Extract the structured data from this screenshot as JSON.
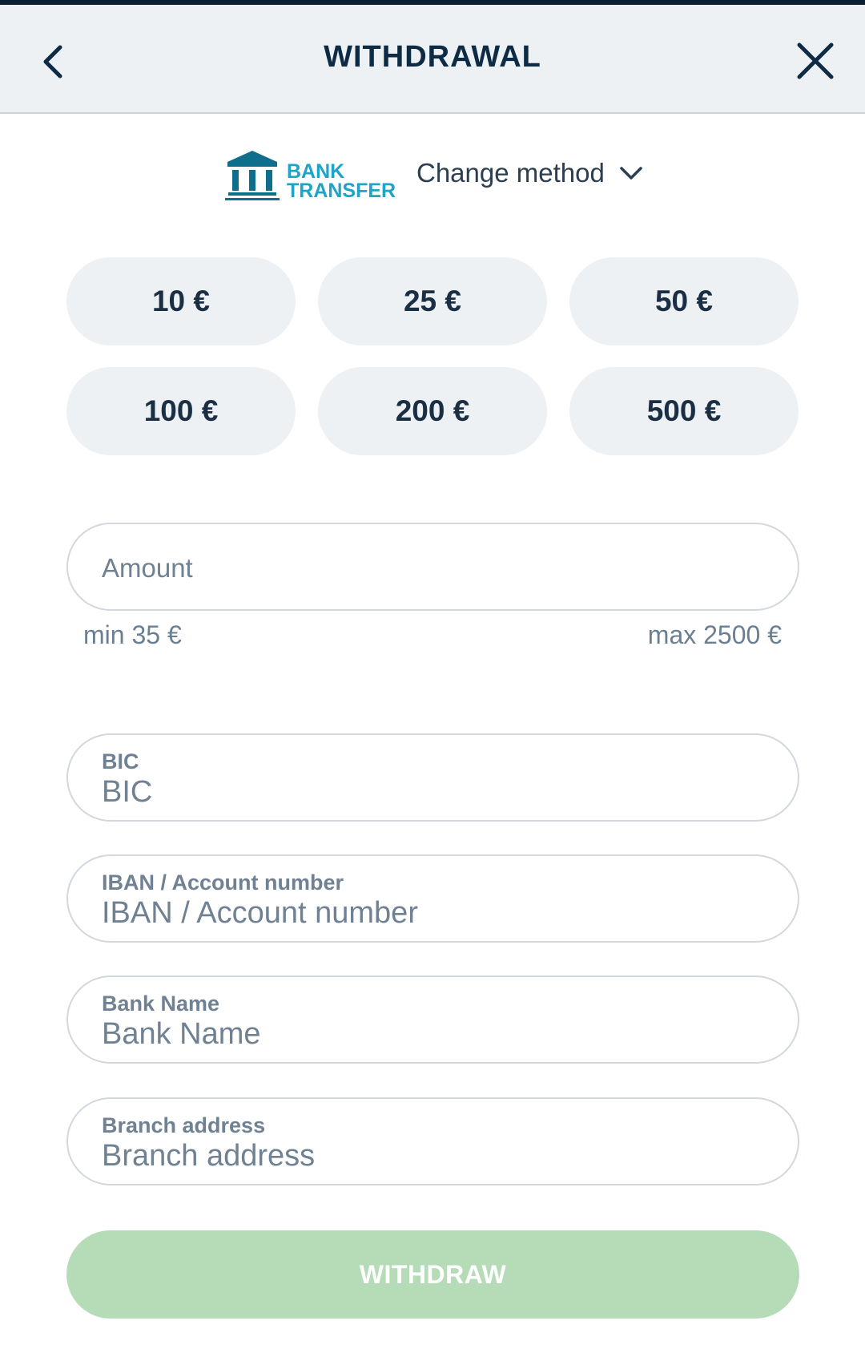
{
  "header": {
    "title": "WITHDRAWAL",
    "back_icon": "chevron-left-icon",
    "close_icon": "close-icon"
  },
  "method": {
    "logo_line1": "BANK",
    "logo_line2": "TRANSFER",
    "change_label": "Change method",
    "chevron_icon": "chevron-down-icon"
  },
  "quick_amounts": [
    "10 €",
    "25 €",
    "50 €",
    "100 €",
    "200 €",
    "500 €"
  ],
  "amount": {
    "placeholder": "Amount",
    "min_label": "min 35 €",
    "max_label": "max 2500 €"
  },
  "fields": [
    {
      "label": "BIC",
      "placeholder": "BIC"
    },
    {
      "label": "IBAN / Account number",
      "placeholder": "IBAN / Account number"
    },
    {
      "label": "Bank Name",
      "placeholder": "Bank Name"
    },
    {
      "label": "Branch address",
      "placeholder": "Branch address"
    }
  ],
  "submit": {
    "label": "WITHDRAW"
  },
  "colors": {
    "header_bg": "#eef1f4",
    "accent_text": "#0e2b45",
    "logo_blue": "#1fa3c7",
    "submit_disabled": "#b5dcb7"
  }
}
